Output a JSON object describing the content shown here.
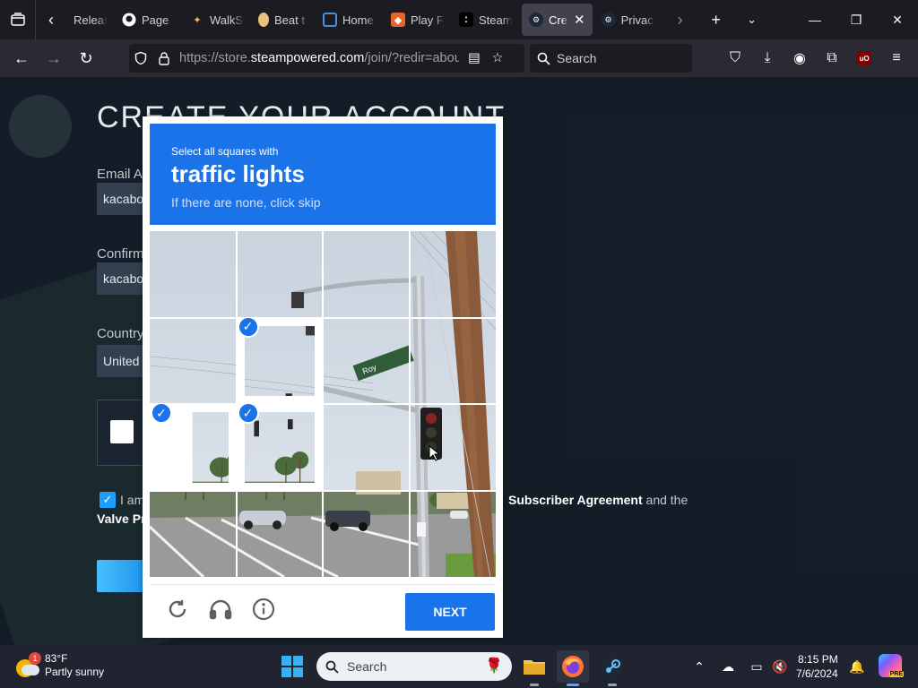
{
  "browser": {
    "tabs": [
      {
        "title": "Releases",
        "icon": "back-arrow-icon",
        "active": false
      },
      {
        "title": "Page",
        "icon": "github-icon",
        "active": false
      },
      {
        "title": "WalkS",
        "icon": "star-icon",
        "active": false
      },
      {
        "title": "Beat t",
        "icon": "bread-icon",
        "active": false
      },
      {
        "title": "Home",
        "icon": "monitor-icon",
        "active": false
      },
      {
        "title": "Play F",
        "icon": "fox-icon",
        "active": false
      },
      {
        "title": "Steam",
        "icon": "dots-icon",
        "active": false
      },
      {
        "title": "Cre",
        "icon": "steam-icon",
        "active": true
      },
      {
        "title": "Privac",
        "icon": "steam-icon",
        "active": false
      }
    ],
    "url_prefix": "https://store.",
    "url_domain": "steampowered.com",
    "url_suffix": "/join/?redir=about",
    "search_placeholder": "Search",
    "ublock_label": "uO"
  },
  "page": {
    "title": "CREATE YOUR ACCOUNT",
    "email_label": "Email A",
    "email_value": "kacabo",
    "confirm_label": "Confirm",
    "confirm_value": "kacabo",
    "country_label": "Country",
    "country_value": "United",
    "agree_prefix": "I am",
    "agree_link": "Subscriber Agreement",
    "agree_suffix": " and the",
    "valve_privacy": "Valve Pr"
  },
  "captcha": {
    "line1": "Select all squares with",
    "line2": "traffic lights",
    "line3": "If there are none, click skip",
    "selected_tiles": [
      5,
      8,
      9
    ],
    "next_label": "NEXT",
    "colors": {
      "accent": "#1a73e8"
    }
  },
  "taskbar": {
    "temperature": "83°F",
    "condition": "Partly sunny",
    "weather_badge": "1",
    "search_placeholder": "Search",
    "time": "8:15 PM",
    "date": "7/6/2024",
    "copilot_badge": "PRE"
  }
}
